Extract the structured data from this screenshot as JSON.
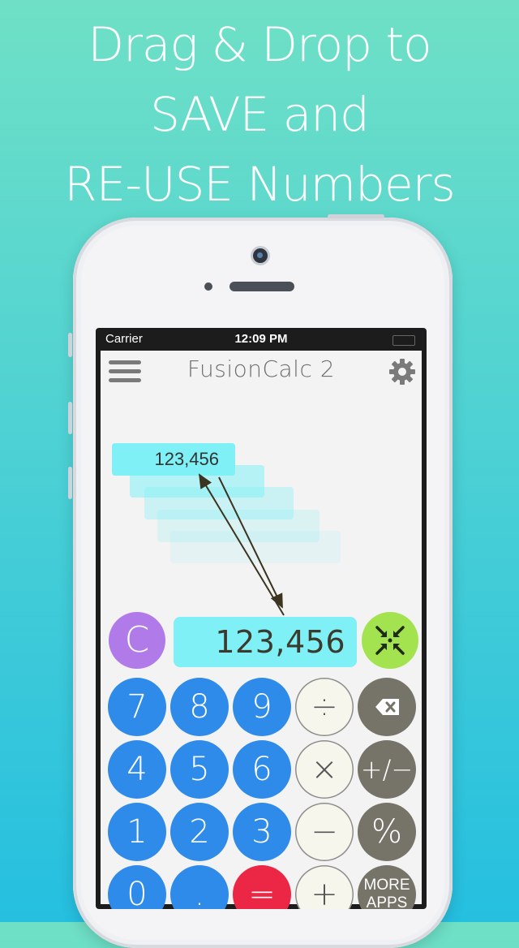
{
  "headline": {
    "line1": "Drag & Drop to",
    "line2": "SAVE and",
    "line3": "RE-USE Numbers"
  },
  "statusbar": {
    "carrier": "Carrier",
    "time": "12:09 PM"
  },
  "app": {
    "title": "FusionCalc 2"
  },
  "history": {
    "top_value": "123,456"
  },
  "display": {
    "value": "123,456"
  },
  "keys": {
    "clear": "C",
    "seven": "7",
    "eight": "8",
    "nine": "9",
    "divide": "÷",
    "four": "4",
    "five": "5",
    "six": "6",
    "multiply": "×",
    "plus_minus": "+/−",
    "one": "1",
    "two": "2",
    "three": "3",
    "minus": "−",
    "percent": "%",
    "zero": "0",
    "decimal": ".",
    "equals": "=",
    "plus": "+",
    "more_apps_line1": "MORE",
    "more_apps_line2": "APPS"
  },
  "colors": {
    "clear": "#b07be9",
    "digits": "#2f8be9",
    "operators": "#f6f6ec",
    "functions": "#767369",
    "equals": "#ec2645",
    "fusion": "#a4e350",
    "display": "#7ff0f5"
  }
}
